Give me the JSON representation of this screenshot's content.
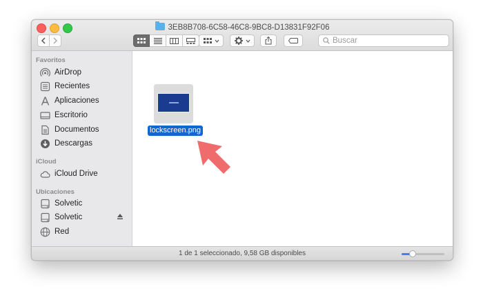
{
  "window": {
    "title": "3EB8B708-6C58-46C8-9BC8-D13831F92F06",
    "title_icon": "folder-icon"
  },
  "toolbar": {
    "back_icon": "chevron-left-icon",
    "forward_icon": "chevron-right-icon",
    "view_modes": [
      {
        "name": "icon-view",
        "icon": "grid-icon",
        "active": true
      },
      {
        "name": "list-view",
        "icon": "list-icon",
        "active": false
      },
      {
        "name": "column-view",
        "icon": "columns-icon",
        "active": false
      },
      {
        "name": "gallery-view",
        "icon": "gallery-icon",
        "active": false
      }
    ],
    "search_placeholder": "Buscar"
  },
  "sidebar": {
    "sections": [
      {
        "heading": "Favoritos",
        "items": [
          {
            "label": "AirDrop",
            "icon": "airdrop-icon"
          },
          {
            "label": "Recientes",
            "icon": "clock-icon"
          },
          {
            "label": "Aplicaciones",
            "icon": "applications-icon"
          },
          {
            "label": "Escritorio",
            "icon": "desktop-icon"
          },
          {
            "label": "Documentos",
            "icon": "document-icon"
          },
          {
            "label": "Descargas",
            "icon": "download-icon"
          }
        ]
      },
      {
        "heading": "iCloud",
        "items": [
          {
            "label": "iCloud Drive",
            "icon": "cloud-icon"
          }
        ]
      },
      {
        "heading": "Ubicaciones",
        "items": [
          {
            "label": "Solvetic",
            "icon": "disk-icon"
          },
          {
            "label": "Solvetic",
            "icon": "disk-icon",
            "eject": true
          },
          {
            "label": "Red",
            "icon": "network-icon"
          }
        ]
      }
    ]
  },
  "content": {
    "files": [
      {
        "name": "lockscreen.png",
        "selected": true
      }
    ],
    "annotation_icon": "arrow-icon"
  },
  "status": {
    "text": "1 de 1 seleccionado, 9,58 GB disponibles",
    "zoom_level": 0.25
  },
  "colors": {
    "selection": "#1464d2",
    "arrow": "#f06b6b",
    "thumbnail": "#1a3b8f",
    "slider_accent": "#3b82f6"
  }
}
